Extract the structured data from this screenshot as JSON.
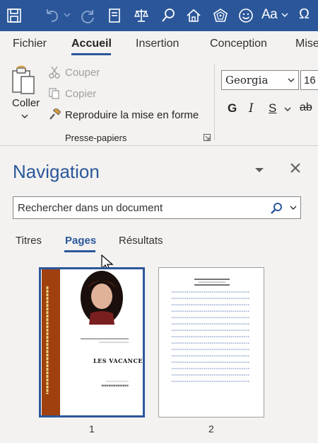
{
  "title_bar": {
    "icons": [
      "save-icon",
      "undo-icon",
      "redo-icon",
      "form-icon",
      "scales-icon",
      "search-icon",
      "home-icon",
      "web-icon",
      "smiley-icon",
      "change-case-icon",
      "omega-icon"
    ],
    "change_case_label": "Aa",
    "omega_label": "Ω",
    "color": "#2b579a"
  },
  "ribbon_tabs": {
    "items": [
      {
        "label": "Fichier"
      },
      {
        "label": "Accueil",
        "active": true
      },
      {
        "label": "Insertion"
      },
      {
        "label": "Conception"
      },
      {
        "label": "Mise"
      }
    ]
  },
  "clipboard_group": {
    "paste_label": "Coller",
    "cut_label": "Couper",
    "copy_label": "Copier",
    "format_painter_label": "Reproduire la mise en forme",
    "group_label": "Presse-papiers"
  },
  "font_group": {
    "font_name": "Georgia",
    "font_size": "16",
    "bold_label": "G",
    "italic_label": "I",
    "underline_label": "S",
    "strikethrough_label": "ab"
  },
  "navigation": {
    "title": "Navigation",
    "search_placeholder": "Rechercher dans un document",
    "tabs": [
      {
        "label": "Titres"
      },
      {
        "label": "Pages",
        "active": true
      },
      {
        "label": "Résultats"
      }
    ],
    "pages": [
      {
        "number": "1",
        "selected": true
      },
      {
        "number": "2"
      }
    ]
  },
  "colors": {
    "accent": "#2b579a",
    "book_spine": "#a0400f"
  }
}
